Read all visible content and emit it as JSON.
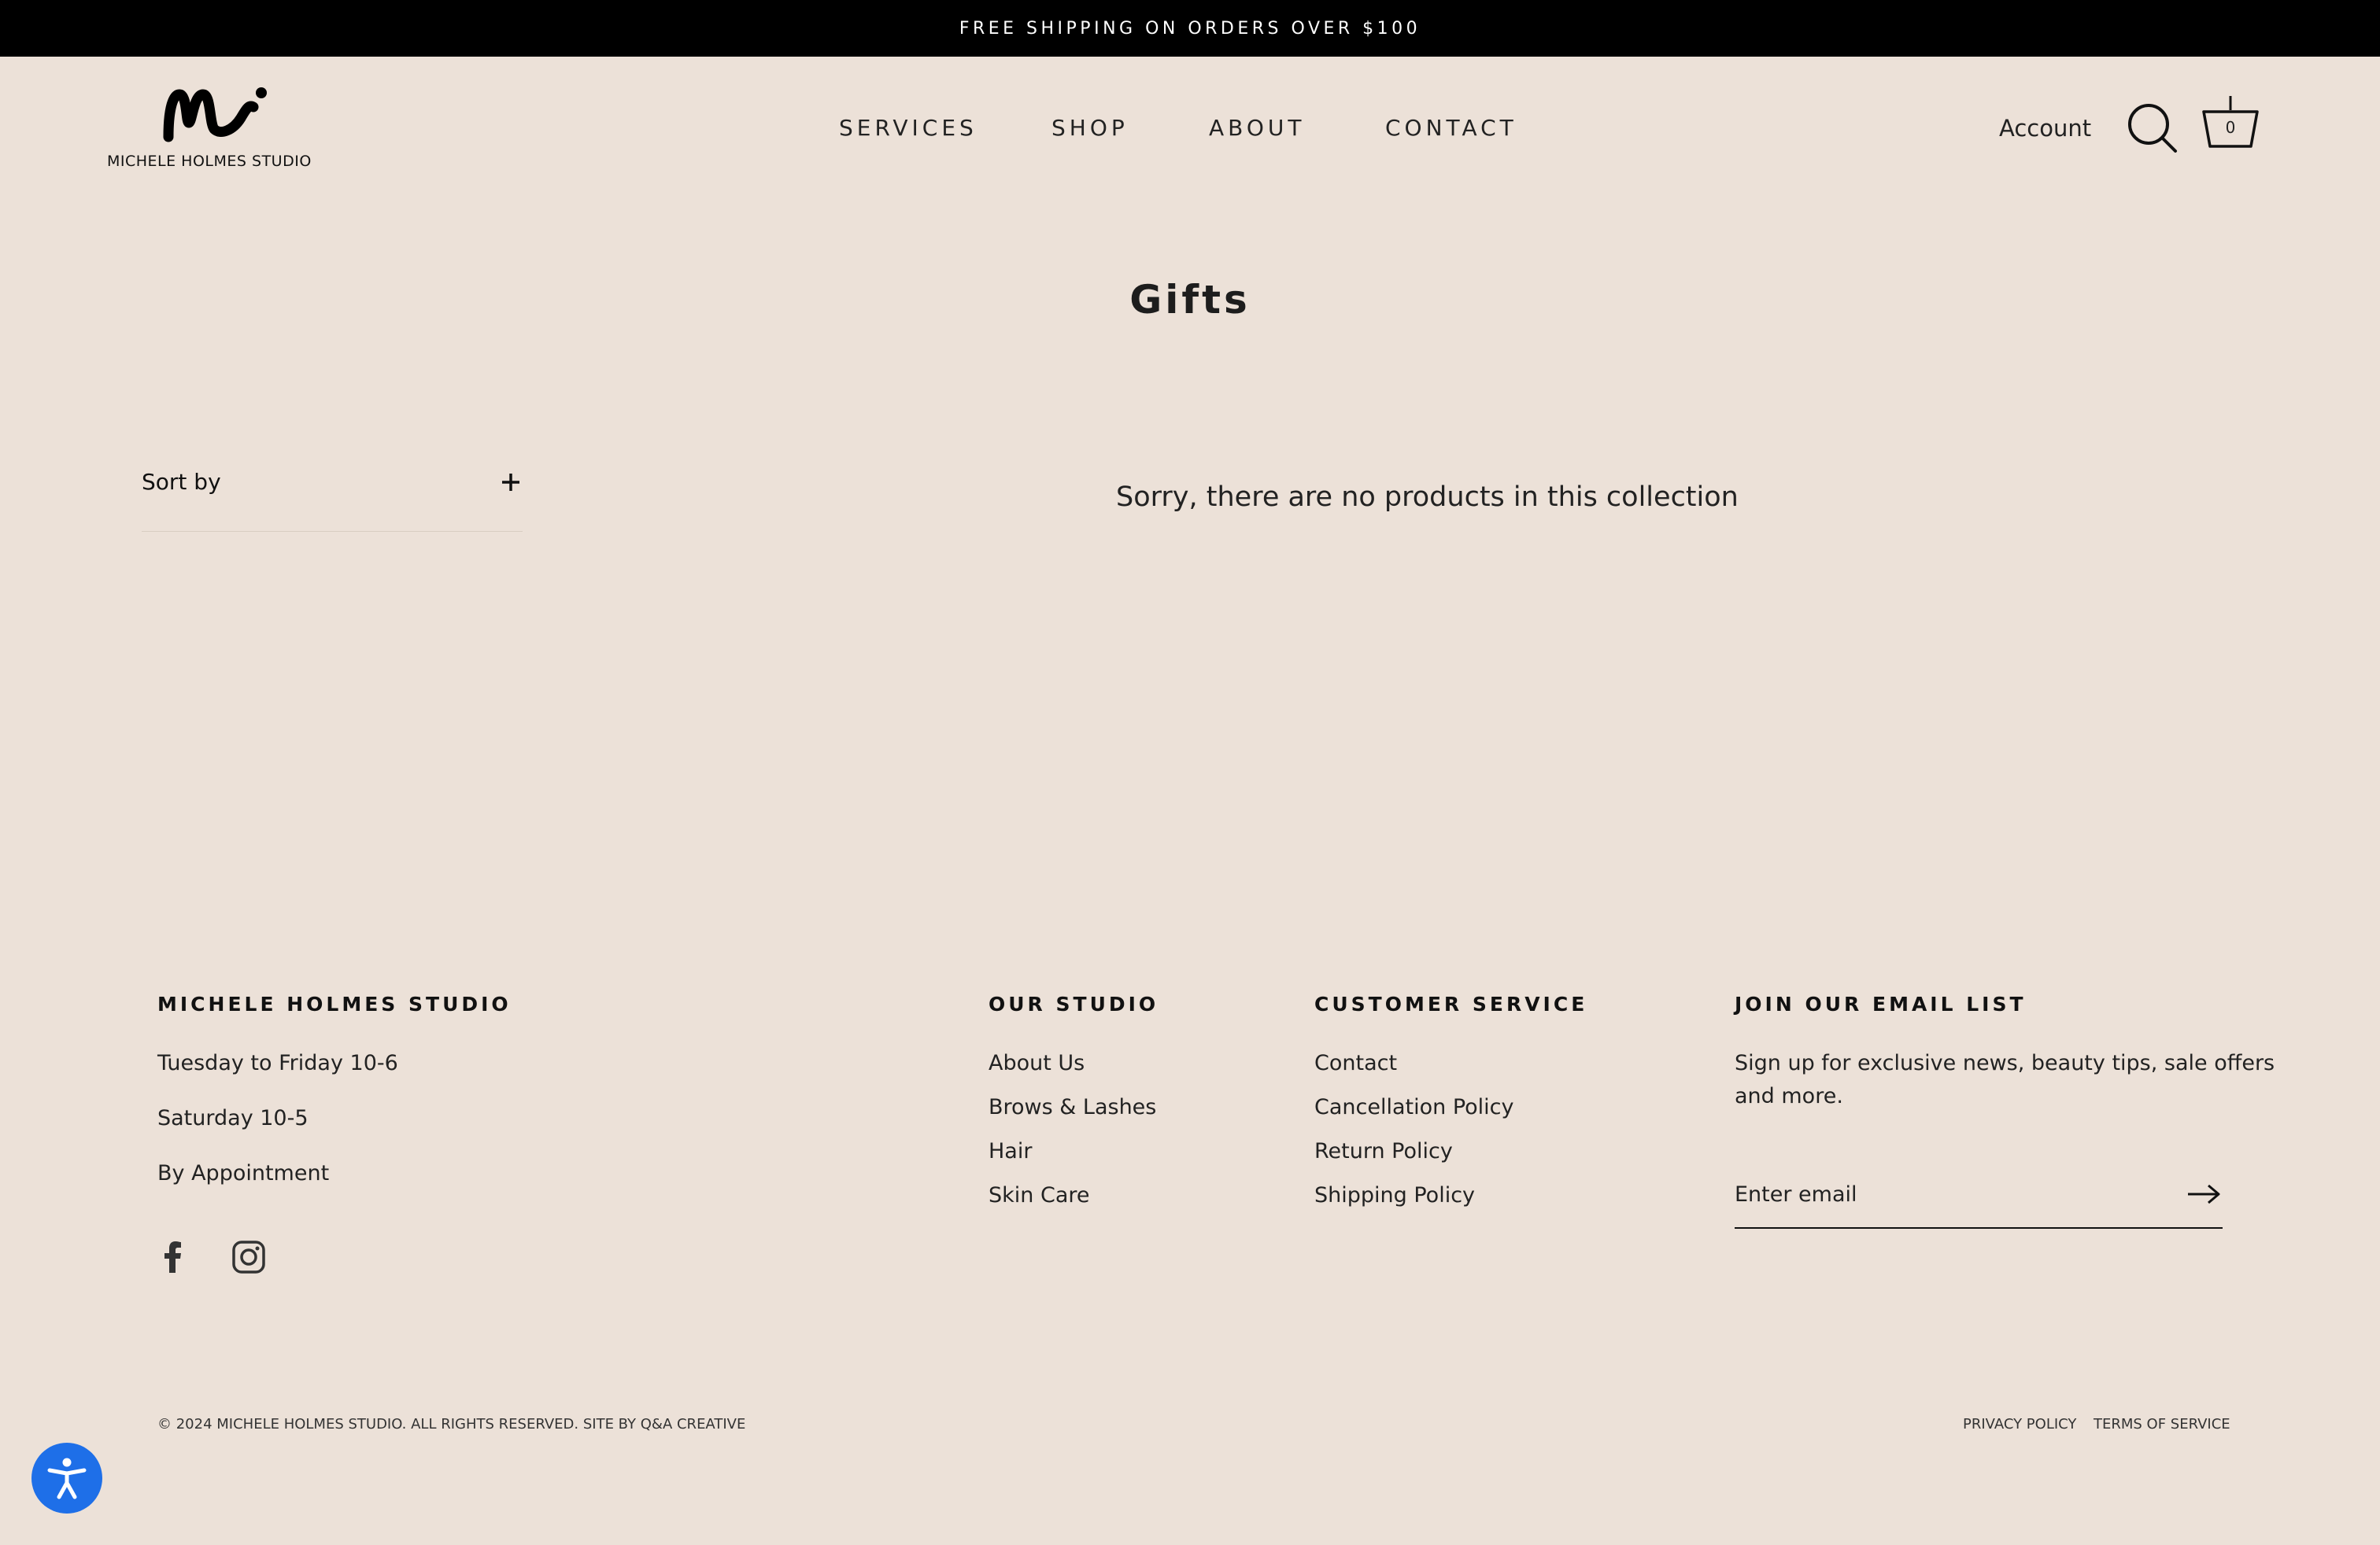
{
  "announcement": "FREE SHIPPING ON ORDERS OVER $100",
  "brand": {
    "logo_text": "MICHELE HOLMES STUDIO"
  },
  "nav": {
    "items": [
      "SERVICES",
      "SHOP",
      "ABOUT",
      "CONTACT"
    ]
  },
  "header": {
    "account_label": "Account",
    "cart_count": "0"
  },
  "page": {
    "title": "Gifts",
    "sort_label": "Sort by",
    "empty_message": "Sorry, there are no products in this collection"
  },
  "footer": {
    "studio": {
      "heading": "MICHELE HOLMES STUDIO",
      "hours": [
        "Tuesday to Friday 10-6",
        "Saturday 10-5",
        "By Appointment"
      ]
    },
    "our_studio": {
      "heading": "OUR STUDIO",
      "links": [
        "About Us",
        "Brows & Lashes",
        "Hair",
        "Skin Care"
      ]
    },
    "customer_service": {
      "heading": "CUSTOMER SERVICE",
      "links": [
        "Contact",
        "Cancellation Policy",
        "Return Policy",
        "Shipping Policy"
      ]
    },
    "email_list": {
      "heading": "JOIN OUR EMAIL LIST",
      "blurb_line1": "Sign up for exclusive news, beauty tips, sale offers",
      "blurb_line2": "and more.",
      "placeholder": "Enter email"
    },
    "copyright": "© 2024 MICHELE HOLMES STUDIO. ALL RIGHTS RESERVED. SITE BY Q&A CREATIVE",
    "privacy": "PRIVACY POLICY",
    "terms": "TERMS OF SERVICE"
  },
  "icons": {
    "search": "search-icon",
    "cart": "cart-icon",
    "plus": "plus-icon",
    "facebook": "facebook-icon",
    "instagram": "instagram-icon",
    "arrow": "arrow-right-icon",
    "accessibility": "accessibility-icon"
  },
  "colors": {
    "background": "#ece1d8",
    "announcement_bg": "#000000",
    "accessibility_button": "#1e6fe8"
  }
}
